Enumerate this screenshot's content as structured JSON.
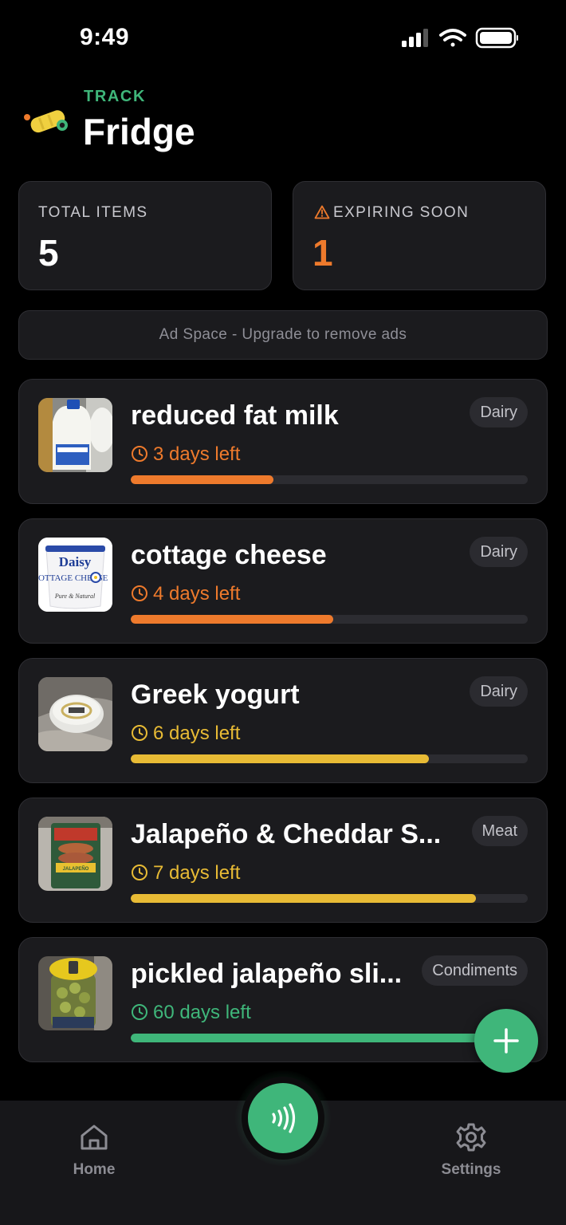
{
  "status": {
    "time": "9:49"
  },
  "header": {
    "kicker": "TRACK",
    "title": "Fridge"
  },
  "stats": {
    "total": {
      "label": "TOTAL ITEMS",
      "value": "5"
    },
    "expiring": {
      "label": "EXPIRING SOON",
      "value": "1"
    }
  },
  "ad": {
    "text": "Ad Space - Upgrade to remove ads"
  },
  "items": [
    {
      "name": "reduced fat milk",
      "days": "3 days left",
      "category": "Dairy",
      "progress": 0.36,
      "color": "#ee7a2c",
      "icon": "milk-jug-photo"
    },
    {
      "name": "cottage cheese",
      "days": "4 days left",
      "category": "Dairy",
      "progress": 0.51,
      "color": "#ee7a2c",
      "icon": "cottage-cheese-photo",
      "thumb_brand": "Daisy",
      "thumb_product": "COTTAGE CHEESE",
      "thumb_tagline": "Pure & Natural"
    },
    {
      "name": "Greek yogurt",
      "days": "6 days left",
      "category": "Dairy",
      "progress": 0.75,
      "color": "#e8bb35",
      "icon": "yogurt-tub-photo"
    },
    {
      "name": "Jalapeño & Cheddar S...",
      "days": "7 days left",
      "category": "Meat",
      "progress": 0.87,
      "color": "#e8bb35",
      "icon": "sausage-pack-photo",
      "thumb_label": "JALAPEÑO"
    },
    {
      "name": "pickled jalapeño sli...",
      "days": "60 days left",
      "category": "Condiments",
      "progress": 0.97,
      "color": "#3fb67a",
      "icon": "jar-photo"
    }
  ],
  "nav": {
    "home": "Home",
    "settings": "Settings"
  },
  "colors": {
    "accent": "#3fb67a",
    "warning": "#ee7a2c",
    "caution": "#e8bb35",
    "card": "#1b1b1e"
  }
}
